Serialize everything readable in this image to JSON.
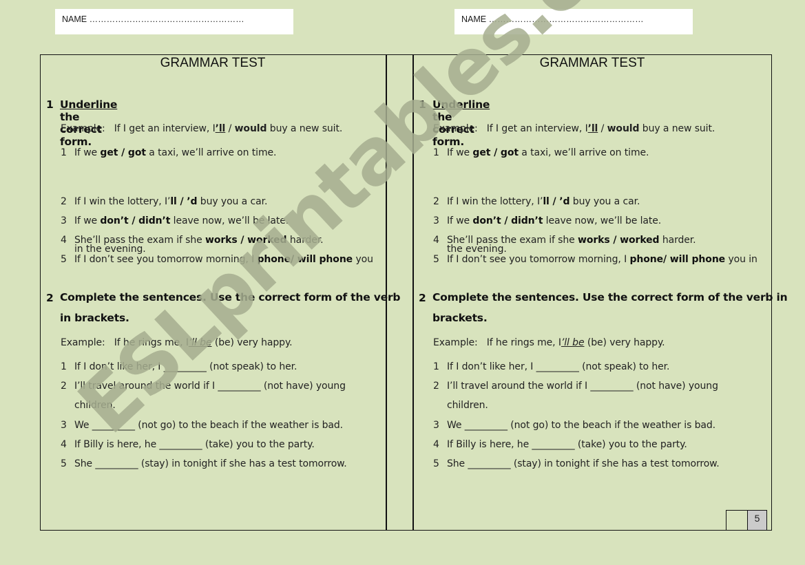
{
  "name_field": {
    "label": "NAME",
    "dots": "………………………………………………"
  },
  "watermark": "ESLprintables.com",
  "score": {
    "value": "5"
  },
  "sheets": [
    {
      "title": "GRAMMAR TEST",
      "section1": {
        "number": "1",
        "heading_underlined": "Underline",
        "heading_rest": " the correct form.",
        "example_label": "Example:",
        "example_pre": "If I get an interview, I",
        "example_underlined": "’ll",
        "example_mid": " / ",
        "example_bold": "would",
        "example_post": " buy a new suit.",
        "items": [
          {
            "n": "1",
            "pre": "If we ",
            "opt": "get / got",
            "post": " a taxi, we’ll arrive on time."
          },
          {
            "n": "2",
            "pre": "If I win the lottery, I’",
            "opt": "ll / ’d",
            "post": " buy you a car."
          },
          {
            "n": "3",
            "pre": "If we ",
            "opt": "don’t / didn’t",
            "post": " leave now, we’ll be late."
          },
          {
            "n": "4",
            "pre": "She’ll pass the exam if she ",
            "opt": "works / worked",
            "post": " harder."
          },
          {
            "n": "5",
            "pre": "If I don’t see you tomorrow morning, I ",
            "opt": "phone/ will phone",
            "post": " you",
            "cont": "in the evening."
          }
        ]
      },
      "section2": {
        "number": "2",
        "heading_line1": "Complete the sentences. Use the correct form of the verb",
        "heading_line2": "in brackets.",
        "example_label": "Example:",
        "example_pre": "If he rings me, I",
        "example_underlined": "’ll be",
        "example_post": " (be) very happy.",
        "items": [
          {
            "n": "1",
            "text": "If I don’t  like her, I _________ (not speak) to her."
          },
          {
            "n": "2",
            "text": "I’ll travel around the world if I _________ (not have) young",
            "cont": "children."
          },
          {
            "n": "3",
            "text": "We _________ (not go) to the beach if the weather is bad."
          },
          {
            "n": "4",
            "text": "If Billy is here, he _________ (take) you to the party."
          },
          {
            "n": "5",
            "text": "She _________ (stay) in tonight if she has a test tomorrow."
          }
        ]
      }
    },
    {
      "title": "GRAMMAR TEST",
      "section1": {
        "number": "1",
        "heading_underlined": "Underline",
        "heading_rest": " the correct form.",
        "example_label": "Example:",
        "example_pre": "If I get an interview, I",
        "example_underlined": "’ll",
        "example_mid": " / ",
        "example_bold": "would",
        "example_post": " buy a new suit.",
        "items": [
          {
            "n": "1",
            "pre": "If we ",
            "opt": "get / got",
            "post": " a taxi, we’ll arrive on time."
          },
          {
            "n": "2",
            "pre": "If I win the lottery, I’",
            "opt": "ll / ’d",
            "post": " buy you a car."
          },
          {
            "n": "3",
            "pre": "If we ",
            "opt": "don’t / didn’t",
            "post": " leave now, we’ll be late."
          },
          {
            "n": "4",
            "pre": "She’ll pass the exam if she ",
            "opt": "works / worked",
            "post": " harder."
          },
          {
            "n": "5",
            "pre": "If I don’t see you tomorrow morning, I ",
            "opt": "phone/ will phone",
            "post": " you in",
            "cont": "the evening."
          }
        ]
      },
      "section2": {
        "number": "2",
        "heading_line1": "Complete the sentences. Use the correct form of the verb in",
        "heading_line2": "brackets.",
        "example_label": "Example:",
        "example_pre": "If he rings me, I",
        "example_underlined": "’ll be",
        "example_post": " (be) very happy.",
        "items": [
          {
            "n": "1",
            "text": "If I don’t  like her, I _________ (not speak) to her."
          },
          {
            "n": "2",
            "text": "I’ll travel around the world if I _________ (not have) young",
            "cont": "children."
          },
          {
            "n": "3",
            "text": "We _________ (not go) to the beach if the weather is bad."
          },
          {
            "n": "4",
            "text": "If Billy is here, he _________ (take) you to the party."
          },
          {
            "n": "5",
            "text": "She _________ (stay) in tonight if she has a test tomorrow."
          }
        ]
      }
    }
  ]
}
